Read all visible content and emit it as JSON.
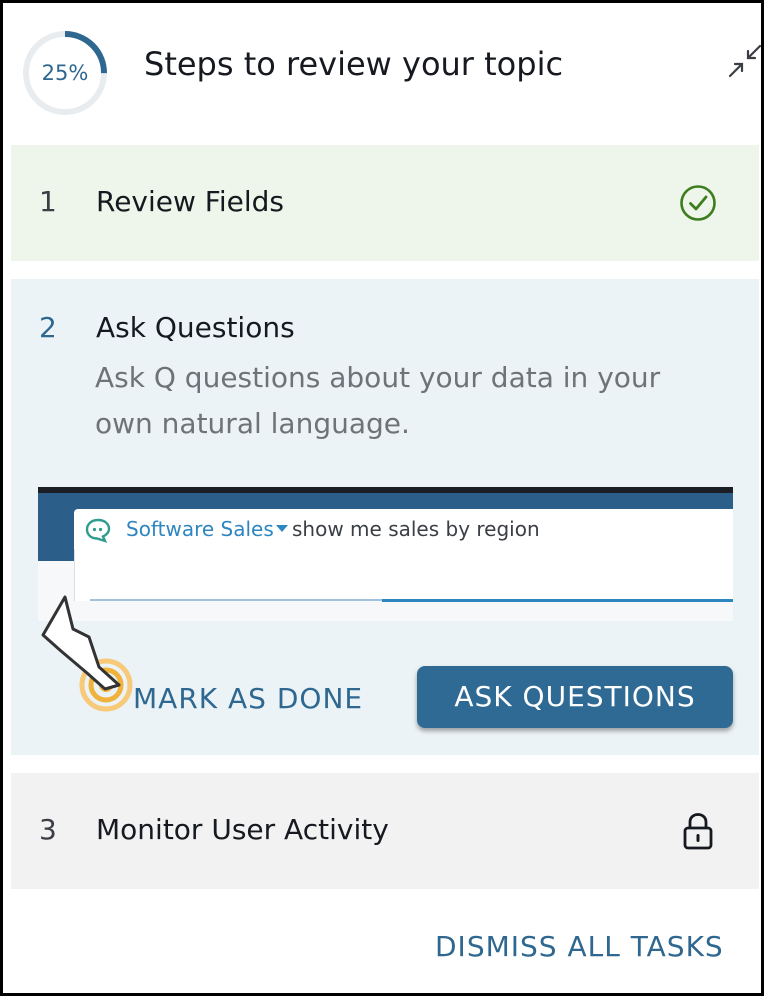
{
  "header": {
    "progress_percent": 25,
    "progress_label": "25%",
    "title": "Steps to review your topic",
    "collapse_icon": "collapse-arrows-icon"
  },
  "steps": [
    {
      "number": "1",
      "title": "Review Fields",
      "status": "complete",
      "status_icon": "check-circle-icon",
      "background": "#eef5ea"
    },
    {
      "number": "2",
      "title": "Ask Questions",
      "description": "Ask Q questions about your data in your own natural language.",
      "status": "active",
      "background": "#ebf3f6",
      "preview": {
        "topic": "Software Sales",
        "query": "show me sales by region"
      },
      "mark_done_label": "MARK AS DONE",
      "primary_action_label": "ASK QUESTIONS"
    },
    {
      "number": "3",
      "title": "Monitor User Activity",
      "status": "locked",
      "status_icon": "lock-icon",
      "background": "#f2f2f2"
    }
  ],
  "footer": {
    "dismiss_label": "DISMISS ALL TASKS"
  },
  "colors": {
    "accent": "#2e6790",
    "button": "#2f6a95",
    "success": "#3c7d1e",
    "highlight": "#f0b23a"
  }
}
